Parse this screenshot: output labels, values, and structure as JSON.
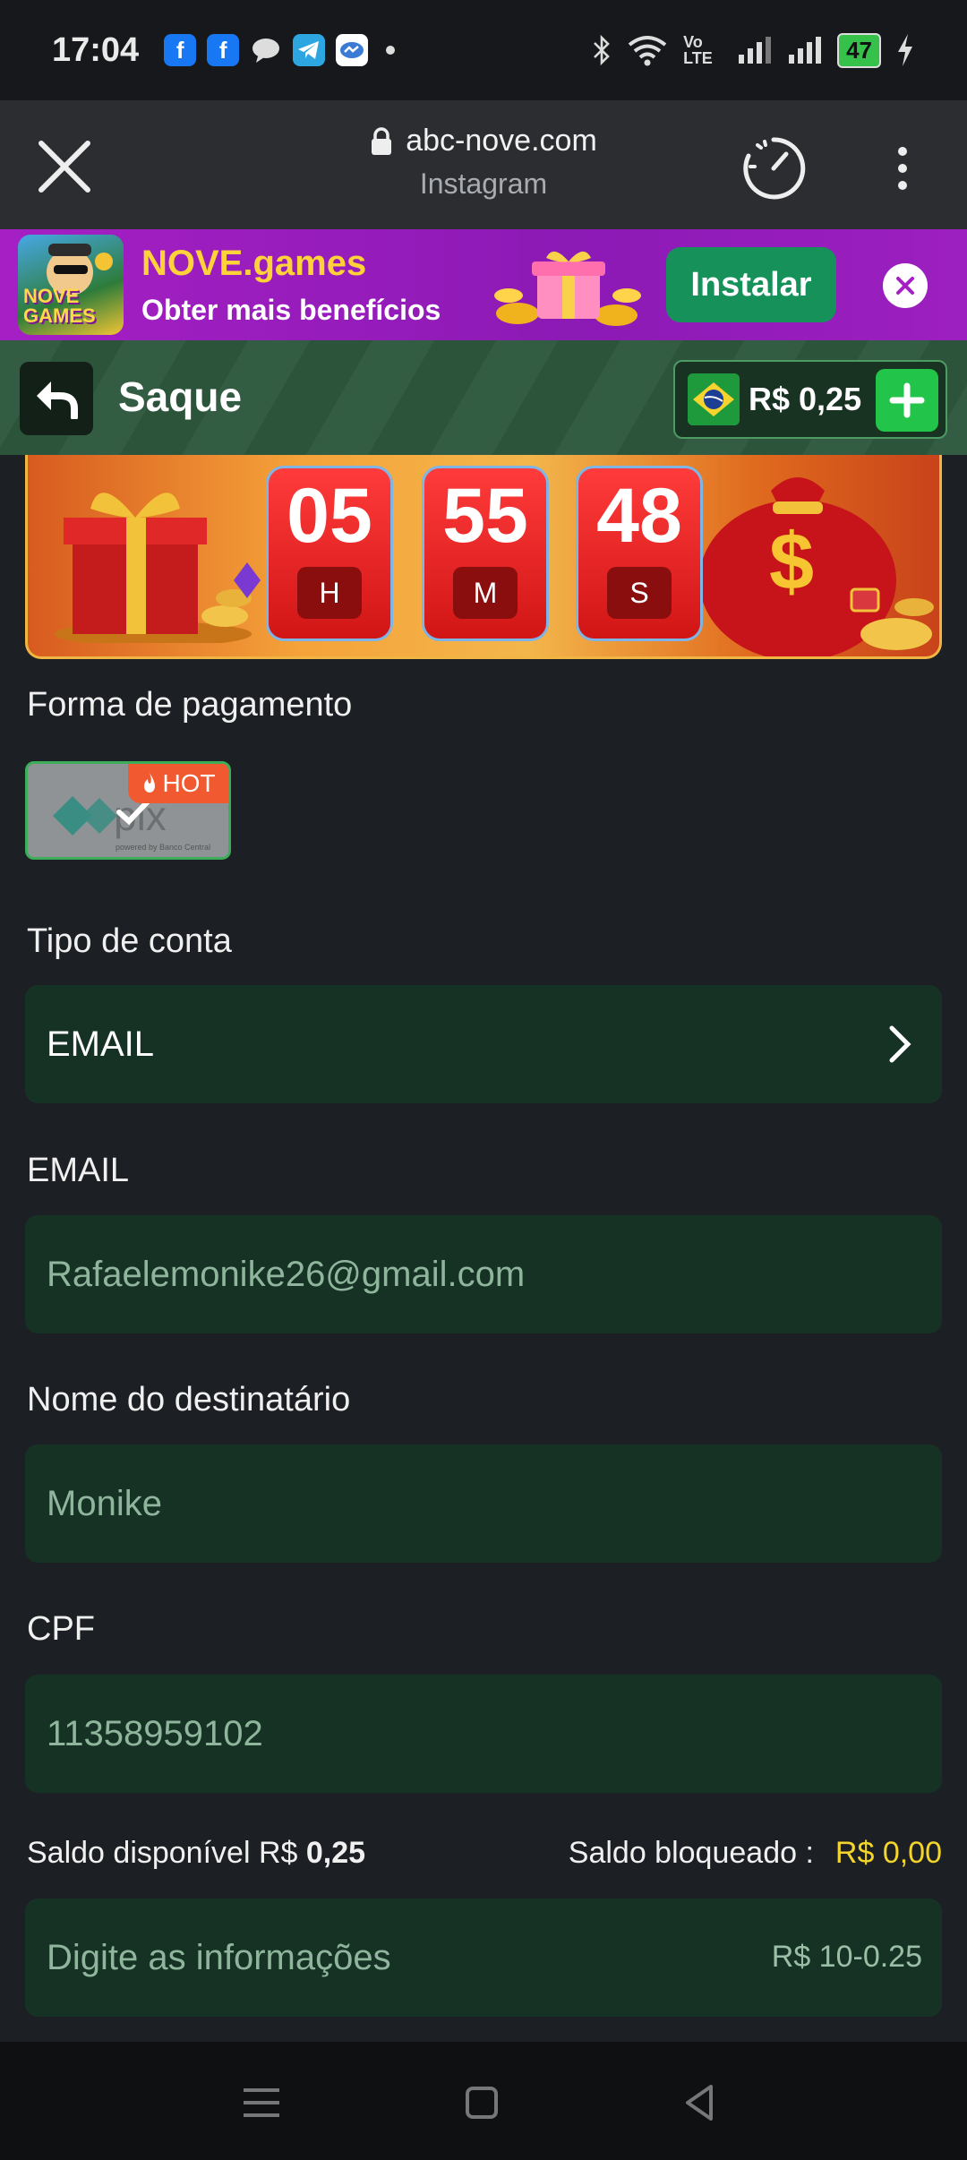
{
  "status_bar": {
    "time": "17:04",
    "apps": [
      "facebook-icon",
      "facebook-icon",
      "chat-bubble-icon",
      "telegram-icon",
      "messenger-icon"
    ],
    "battery": "47",
    "network": "Vo LTE"
  },
  "browser": {
    "domain": "abc-nove.com",
    "subtitle": "Instagram"
  },
  "banner": {
    "title": "NOVE.games",
    "subtitle": "Obter mais benefícios",
    "install_label": "Instalar",
    "logo_text": "NOVE GAMES"
  },
  "header": {
    "title": "Saque",
    "balance": "R$ 0,25"
  },
  "countdown": {
    "hours": "05",
    "hours_unit": "H",
    "minutes": "55",
    "minutes_unit": "M",
    "seconds": "48",
    "seconds_unit": "S"
  },
  "form": {
    "payment_label": "Forma de pagamento",
    "payment_option": {
      "name": "pix",
      "badge": "HOT",
      "caption": "powered by Banco Central"
    },
    "account_type_label": "Tipo de conta",
    "account_type_value": "EMAIL",
    "email_label": "EMAIL",
    "email_value": "Rafaelemonike26@gmail.com",
    "recipient_label": "Nome do destinatário",
    "recipient_value": "Monike",
    "cpf_label": "CPF",
    "cpf_value": "11358959102",
    "available_label": "Saldo disponível R$",
    "available_value": "0,25",
    "blocked_label": "Saldo bloqueado :",
    "blocked_value": "R$ 0,00",
    "amount_placeholder": "Digite as informações",
    "amount_range": "R$ 10-0.25"
  },
  "colors": {
    "accent_green": "#22c44a",
    "field_bg": "#163225",
    "banner_purple": "#a51fc4",
    "blocked_yellow": "#f4d52c"
  }
}
